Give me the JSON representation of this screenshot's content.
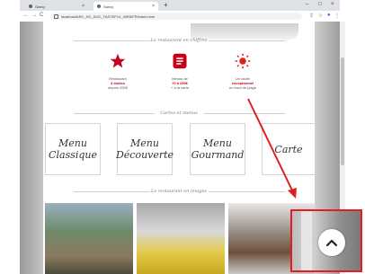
{
  "browser": {
    "tabs": [
      {
        "label": "Sanvy"
      },
      {
        "label": "Sanvy"
      }
    ],
    "new_tab": "+",
    "window_controls": {
      "minimize": "–",
      "maximize": "□",
      "close": "×"
    },
    "url": "localhost/ARC_HC_DOC_TASTEFUL_WEB/FR/index.html",
    "nav": {
      "back": "←",
      "forward": "→",
      "reload": "C"
    }
  },
  "page": {
    "section1_title": "Le restaurant en chiffres",
    "features": [
      {
        "icon": "star-icon",
        "line1": "Restaurant",
        "line2": "3 étoiles",
        "line3": "depuis 2008"
      },
      {
        "icon": "menu-card-icon",
        "line1": "Menus de",
        "line2": "70 à 250€",
        "line3": "+ à la carte"
      },
      {
        "icon": "sun-icon",
        "line1": "Un cadre",
        "line2": "exceptionnel",
        "line3": "en bord de plage"
      }
    ],
    "section2_title": "Cartes et menus",
    "menus": [
      {
        "line1": "Menu",
        "line2": "Classique"
      },
      {
        "line1": "Menu",
        "line2": "Découverte"
      },
      {
        "line1": "Menu",
        "line2": "Gourmand"
      },
      {
        "line1": "Carte",
        "line2": ""
      }
    ],
    "section3_title": "Le restaurant en images"
  },
  "annotation": {
    "color": "#e02020",
    "scroll_top_icon": "chevron-up-icon"
  },
  "colors": {
    "accent": "#c4001a"
  }
}
